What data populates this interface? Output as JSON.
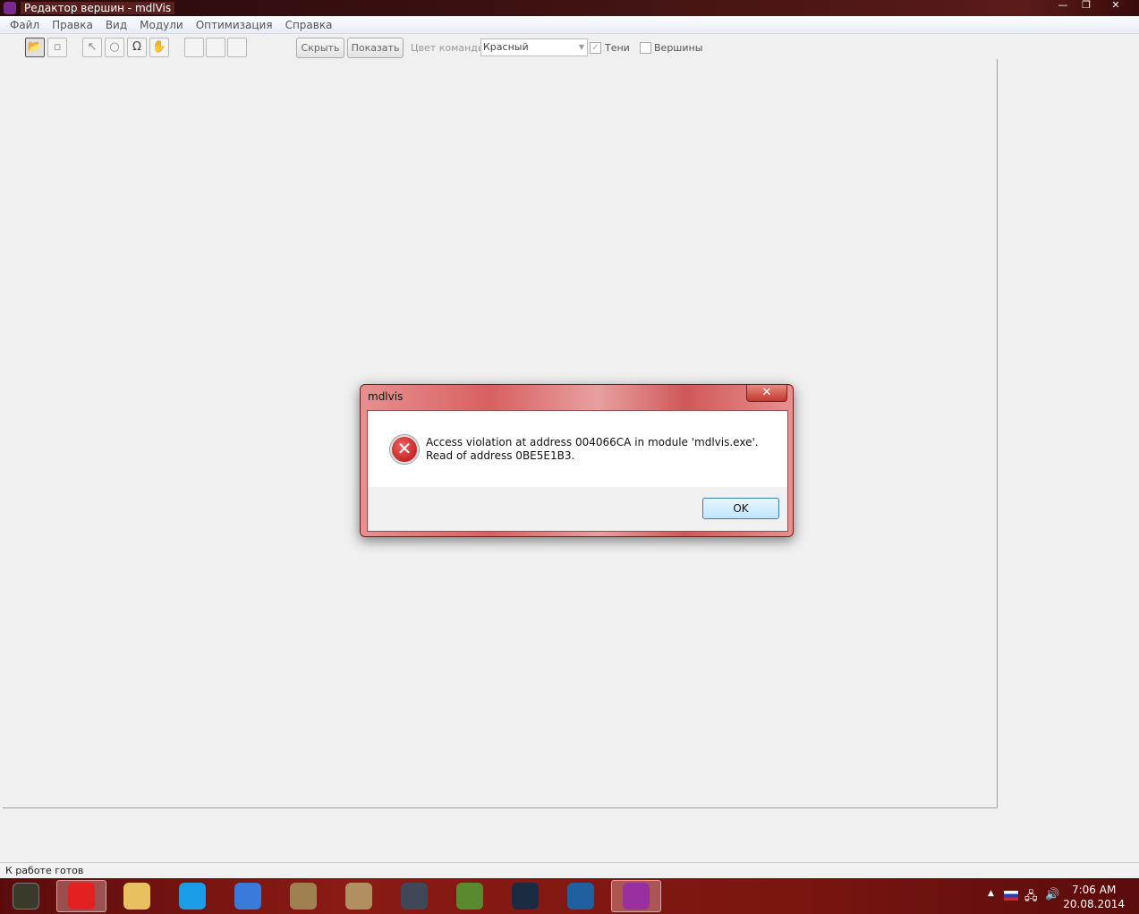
{
  "window": {
    "title": "Редактор вершин - mdlVis",
    "min": "—",
    "max": "❐",
    "close": "✕"
  },
  "menu": [
    "Файл",
    "Правка",
    "Вид",
    "Модули",
    "Оптимизация",
    "Справка"
  ],
  "toolbar": {
    "hide_label": "Скрыть",
    "show_label": "Показать",
    "team_color_label": "Цвет команды:",
    "team_color_value": "Красный",
    "shadows_label": "Тени",
    "shadows_checked": true,
    "vertices_label": "Вершины",
    "vertices_checked": false
  },
  "status": "К работе готов",
  "dialog": {
    "title": "mdlvis",
    "message": "Access violation at address 004066CA in module 'mdlvis.exe'. Read of address 0BE5E1B3.",
    "ok_label": "OK",
    "close": "✕"
  },
  "taskbar": {
    "time": "7:06 AM",
    "date": "20.08.2014",
    "apps": [
      {
        "name": "yandex-browser",
        "color": "#e52020",
        "active": true
      },
      {
        "name": "file-explorer",
        "color": "#e8c060",
        "active": false
      },
      {
        "name": "skype",
        "color": "#1a9ee8",
        "active": false
      },
      {
        "name": "app-c",
        "color": "#3a7ad8",
        "active": false
      },
      {
        "name": "quill-tool",
        "color": "#a08050",
        "active": false
      },
      {
        "name": "scroll-tool",
        "color": "#b09060",
        "active": false
      },
      {
        "name": "warcraft",
        "color": "#404858",
        "active": false
      },
      {
        "name": "minecraft",
        "color": "#5a8a30",
        "active": false
      },
      {
        "name": "steam",
        "color": "#1a2a40",
        "active": false
      },
      {
        "name": "battlenet",
        "color": "#2060a0",
        "active": false
      },
      {
        "name": "mdlvis",
        "color": "#9a30a0",
        "active": true
      }
    ]
  }
}
